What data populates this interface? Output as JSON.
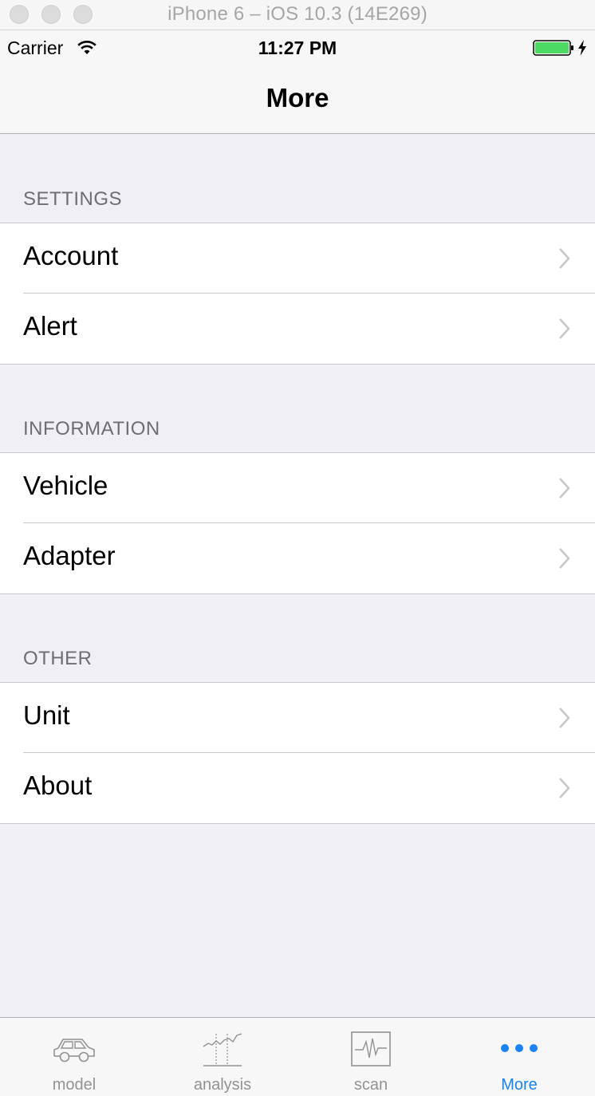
{
  "simulator": {
    "title": "iPhone 6 – iOS 10.3 (14E269)"
  },
  "status_bar": {
    "carrier": "Carrier",
    "time": "11:27 PM",
    "battery_level": 1.0,
    "battery_color": "#4cd964",
    "charging": true
  },
  "nav": {
    "title": "More"
  },
  "sections": [
    {
      "header": "SETTINGS",
      "items": [
        {
          "label": "Account"
        },
        {
          "label": "Alert"
        }
      ]
    },
    {
      "header": "INFORMATION",
      "items": [
        {
          "label": "Vehicle"
        },
        {
          "label": "Adapter"
        }
      ]
    },
    {
      "header": "OTHER",
      "items": [
        {
          "label": "Unit"
        },
        {
          "label": "About"
        }
      ]
    }
  ],
  "tabs": [
    {
      "label": "model",
      "icon": "car-icon",
      "active": false
    },
    {
      "label": "analysis",
      "icon": "analysis-chart-icon",
      "active": false
    },
    {
      "label": "scan",
      "icon": "pulse-scan-icon",
      "active": false
    },
    {
      "label": "More",
      "icon": "more-dots-icon",
      "active": true
    }
  ],
  "colors": {
    "accent": "#1a82f2",
    "inactive_tab": "#929292",
    "background": "#efeff4"
  }
}
